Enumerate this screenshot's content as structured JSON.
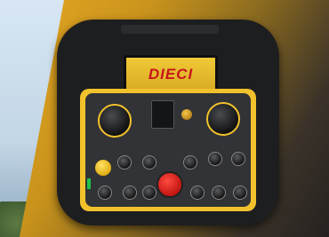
{
  "photo": {
    "subject": "",
    "brand_logo_text": "DIECI",
    "colors": {
      "body": "#1d1e20",
      "faceplate": "#f2c22c",
      "emergency_stop": "#e2231a",
      "logo": "#c8141b",
      "background_gold": "#d69e22"
    }
  }
}
